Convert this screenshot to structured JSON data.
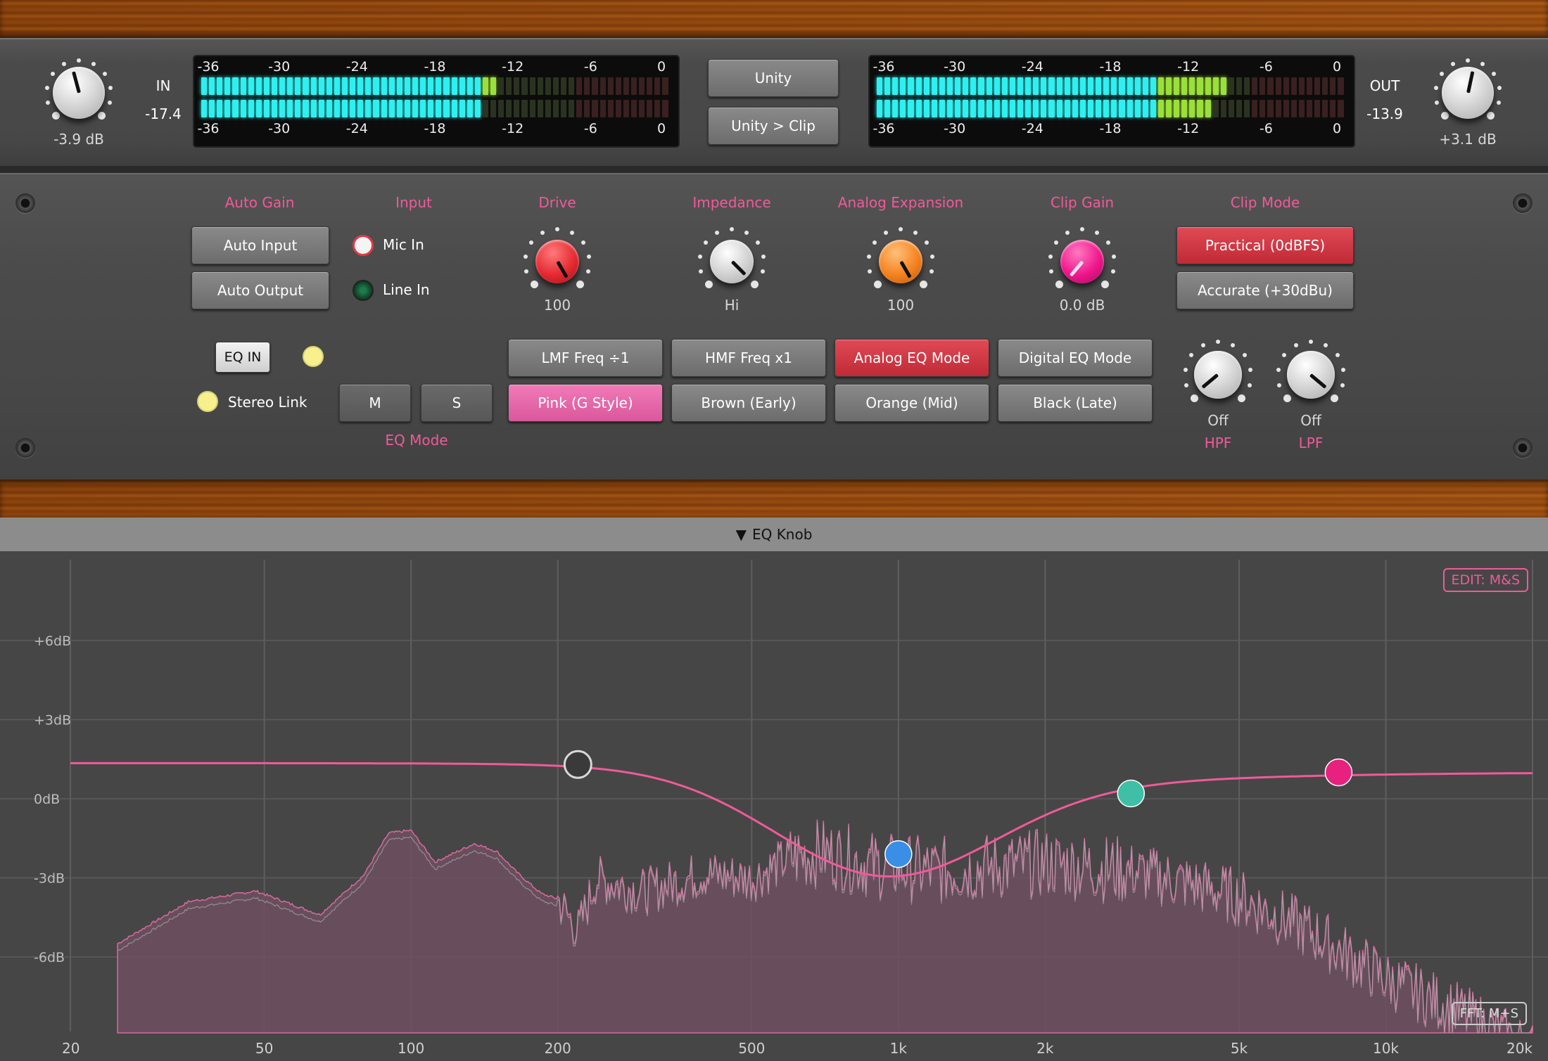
{
  "input": {
    "label": "IN",
    "level": "-17.4",
    "gain": "-3.9 dB"
  },
  "output": {
    "label": "OUT",
    "level": "-13.9",
    "gain": "+3.1 dB"
  },
  "meter_scale": [
    "-36",
    "-30",
    "-24",
    "-18",
    "-12",
    "-6",
    "0"
  ],
  "meters": {
    "in": {
      "lit_segments": [
        38,
        36
      ]
    },
    "out": {
      "lit_segments": [
        45,
        43
      ]
    }
  },
  "unity": {
    "unity_label": "Unity",
    "unity_clip_label": "Unity > Clip"
  },
  "auto_gain": {
    "title": "Auto Gain",
    "auto_input": "Auto Input",
    "auto_output": "Auto Output"
  },
  "input_select": {
    "title": "Input",
    "mic": "Mic In",
    "line": "Line In"
  },
  "drive": {
    "title": "Drive",
    "value": "100",
    "color": "#e52a32"
  },
  "impedance": {
    "title": "Impedance",
    "value": "Hi"
  },
  "analog_expansion": {
    "title": "Analog Expansion",
    "value": "100",
    "color": "#f58220"
  },
  "clip_gain": {
    "title": "Clip Gain",
    "value": "0.0 dB",
    "color": "#f0168c"
  },
  "clip_mode": {
    "title": "Clip Mode",
    "practical": "Practical (0dBFS)",
    "accurate": "Accurate (+30dBu)"
  },
  "eq": {
    "eq_in": "EQ IN",
    "stereo_link": "Stereo Link",
    "mode_m": "M",
    "mode_s": "S",
    "mode_title": "EQ Mode"
  },
  "eq_buttons": {
    "lmf": "LMF Freq ÷1",
    "hmf": "HMF Freq x1",
    "analog": "Analog EQ Mode",
    "digital": "Digital EQ Mode",
    "pink": "Pink (G Style)",
    "brown": "Brown (Early)",
    "orange": "Orange (Mid)",
    "black": "Black (Late)"
  },
  "hpf": {
    "title": "HPF",
    "value": "Off"
  },
  "lpf": {
    "title": "LPF",
    "value": "Off"
  },
  "eq_panel": {
    "title": "EQ Knob",
    "edit_tag": "EDIT: M&S",
    "fft_tag": "FFT: M+S"
  },
  "eq_graph": {
    "db_labels": [
      "+6dB",
      "+3dB",
      "0dB",
      "-3dB",
      "-6dB"
    ],
    "freq_labels": [
      "20",
      "50",
      "100",
      "200",
      "500",
      "1k",
      "2k",
      "5k",
      "10k",
      "20k"
    ],
    "bands": [
      {
        "name": "low",
        "freq": 220,
        "gain": 1.3,
        "color": "#3a3a3a"
      },
      {
        "name": "low-mid",
        "freq": 1000,
        "gain": -2.1,
        "color": "#3a8ee6"
      },
      {
        "name": "high-mid",
        "freq": 3000,
        "gain": 0.2,
        "color": "#3fbfa6"
      },
      {
        "name": "high",
        "freq": 8000,
        "gain": 1.0,
        "color": "#e8217e"
      }
    ]
  }
}
